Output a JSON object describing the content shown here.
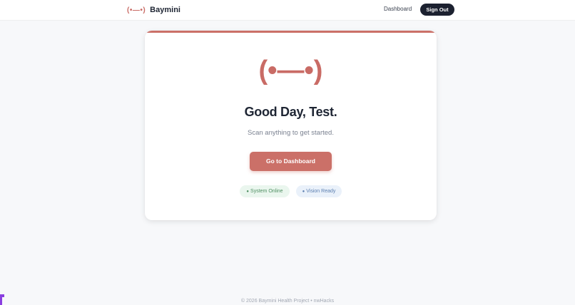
{
  "header": {
    "logo_mark": "(•—•)",
    "brand_name": "Baymini",
    "dashboard_link": "Dashboard",
    "sign_out_label": "Sign Out"
  },
  "card": {
    "logo_mark": "(•—•)",
    "greeting": "Good Day, Test.",
    "subtitle": "Scan anything to get started.",
    "cta_label": "Go to Dashboard",
    "status": [
      {
        "dot": "●",
        "label": "System Online",
        "color": "#4f8f62"
      },
      {
        "dot": "●",
        "label": "Vision Ready",
        "color": "#5c7fb0"
      }
    ]
  },
  "footer": {
    "text": "© 2026 Baymini Health Project • nwHacks"
  },
  "colors": {
    "accent": "#cb7068",
    "dark": "#1c2130",
    "background": "#f7f8fa"
  }
}
